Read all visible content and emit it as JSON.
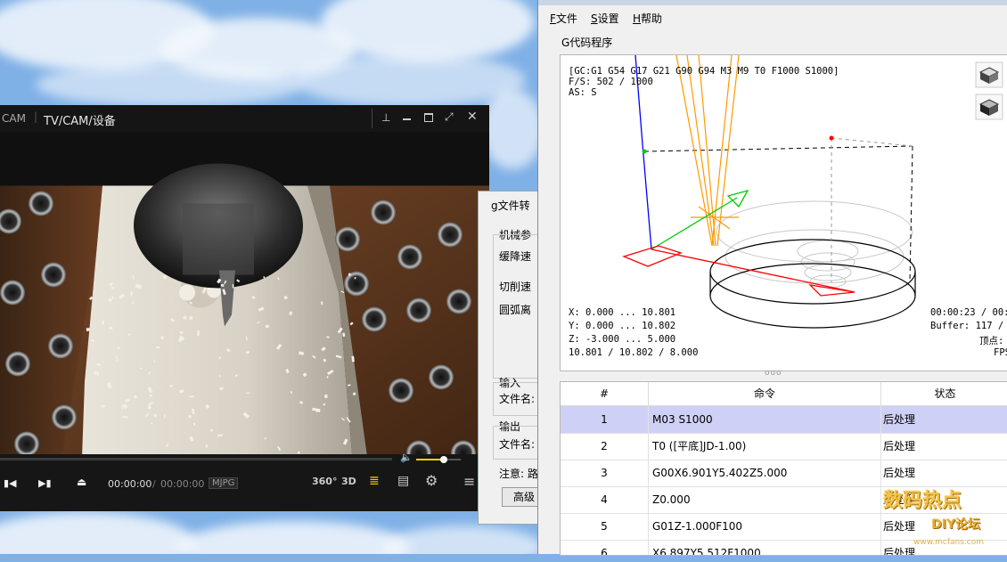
{
  "player": {
    "title_app": "CAM",
    "title_path": "TV/CAM/设备",
    "time_current": "00:00:00",
    "time_separator": "/",
    "time_total": "00:00:00",
    "codec": "MJPG",
    "btn_360": "360°",
    "btn_3d": "3D",
    "volume_level": 0.62
  },
  "converter": {
    "title_fragment": "g文件转",
    "group_machine": "机械参",
    "label_feed_down": "缓降速",
    "label_cut_speed": "切削速",
    "label_arc": "圆弧离",
    "group_input": "输入",
    "label_input_file": "文件名:",
    "group_output": "输出",
    "label_output_file": "文件名:",
    "note": "注意: 路",
    "btn_advanced": "高级"
  },
  "grbl": {
    "menu": [
      {
        "key": "F",
        "label": "文件"
      },
      {
        "key": "S",
        "label": "设置"
      },
      {
        "key": "H",
        "label": "帮助"
      }
    ],
    "group_title": "G代码程序",
    "overlay_top": [
      "[GC:G1 G54 G17 G21 G90 G94 M3 M9 T0 F1000 S1000]",
      "F/S: 502 / 1000",
      "AS: S"
    ],
    "overlay_bottom_left": [
      "X: 0.000 ... 10.801",
      "Y: 0.000 ... 10.802",
      "Z: -3.000 ... 5.000",
      "10.801 / 10.802 / 8.000"
    ],
    "overlay_bottom_right": [
      "00:00:23 / 00:0",
      "Buffer: 117 / 9",
      "顶点:",
      "FPS"
    ],
    "splitter_dots": "ooo",
    "table": {
      "headers": [
        "#",
        "命令",
        "状态"
      ],
      "rows": [
        {
          "n": "1",
          "cmd": "M03 S1000",
          "status": "后处理",
          "selected": true
        },
        {
          "n": "2",
          "cmd": "T0 ([平底]JD-1.00)",
          "status": "后处理",
          "selected": false
        },
        {
          "n": "3",
          "cmd": "G00X6.901Y5.402Z5.000",
          "status": "后处理",
          "selected": false
        },
        {
          "n": "4",
          "cmd": "Z0.000",
          "status": "后处理",
          "selected": false
        },
        {
          "n": "5",
          "cmd": "G01Z-1.000F100",
          "status": "后处理",
          "selected": false
        },
        {
          "n": "6",
          "cmd": "X6.897Y5.512F1000",
          "status": "后处理",
          "selected": false
        }
      ]
    }
  },
  "watermark": {
    "logo_text": "数码热点",
    "sub_text": "DIY论坛",
    "url": "www.mcfans.com"
  },
  "colors": {
    "selected_row": "#cfd0f5",
    "toolpath_orange": "#ff9900",
    "axis_red": "#ff0000",
    "axis_green": "#00cc00",
    "axis_blue": "#0000ff"
  }
}
